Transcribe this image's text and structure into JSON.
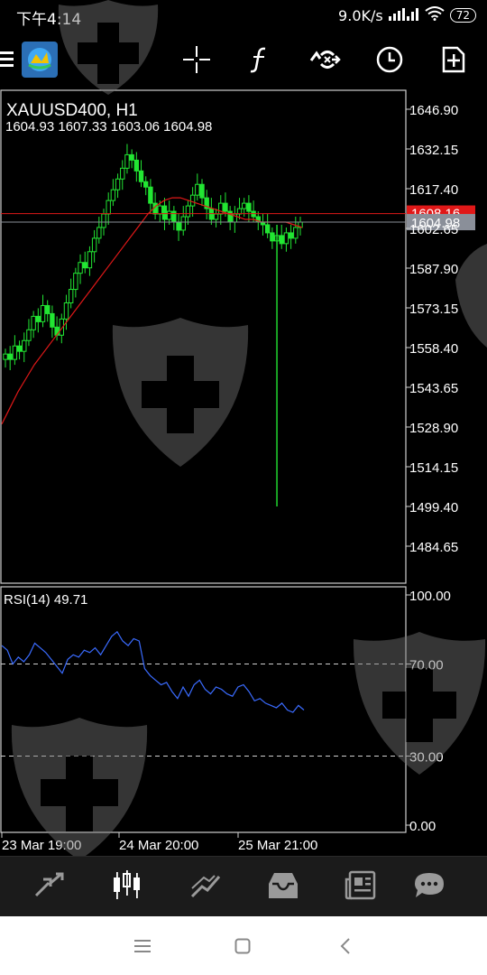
{
  "status_bar": {
    "time": "下午4:14",
    "network_speed": "9.0K/s",
    "battery": "72"
  },
  "toolbar": {
    "buttons": [
      "menu-icon",
      "app-logo-icon",
      "crosshair-icon",
      "function-icon",
      "chart-settings-icon",
      "timeframe-clock-icon",
      "new-order-icon"
    ]
  },
  "chart": {
    "symbol_label": "XAUUSD400, H1",
    "ohlc_label": "1604.93 1607.33 1603.06 1604.98",
    "price_axis": [
      "1646.90",
      "1632.15",
      "1617.40",
      "1602.65",
      "1587.90",
      "1573.15",
      "1558.40",
      "1543.65",
      "1528.90",
      "1514.15",
      "1499.40",
      "1484.65"
    ],
    "ask_label": "1608.16",
    "bid_label": "1604.98",
    "rsi_label": "RSI(14) 49.71",
    "rsi_axis": [
      "100.00",
      "70.00",
      "30.00",
      "0.00"
    ],
    "time_axis": [
      "23 Mar 19:00",
      "24 Mar 20:00",
      "25 Mar 21:00"
    ],
    "colors": {
      "bull": "#22e633",
      "ma": "#e01818",
      "rsi": "#3a6bff",
      "ask": "#e01818",
      "bid": "#8a8f99"
    }
  },
  "bottom_nav": {
    "items": [
      "quotes-icon",
      "chart-icon",
      "trade-icon",
      "history-icon",
      "news-icon",
      "chat-icon"
    ]
  },
  "chart_data": {
    "type": "candlestick",
    "title": "XAUUSD400, H1",
    "ylim": [
      1484.65,
      1646.9
    ],
    "y_ticks": [
      1646.9,
      1632.15,
      1617.4,
      1602.65,
      1587.9,
      1573.15,
      1558.4,
      1543.65,
      1528.9,
      1514.15,
      1499.4,
      1484.65
    ],
    "x_tick_labels": [
      "23 Mar 19:00",
      "24 Mar 20:00",
      "25 Mar 21:00"
    ],
    "last_ohlc": {
      "open": 1604.93,
      "high": 1607.33,
      "low": 1603.06,
      "close": 1604.98
    },
    "current_ask": 1608.16,
    "current_bid": 1604.98,
    "close_series": [
      1556,
      1554,
      1559,
      1557,
      1561,
      1565,
      1570,
      1568,
      1574,
      1571,
      1566,
      1563,
      1569,
      1575,
      1580,
      1586,
      1590,
      1588,
      1594,
      1599,
      1603,
      1608,
      1613,
      1617,
      1621,
      1625,
      1630,
      1628,
      1624,
      1620,
      1618,
      1612,
      1608,
      1611,
      1606,
      1609,
      1605,
      1602,
      1607,
      1611,
      1615,
      1619,
      1614,
      1610,
      1606,
      1608,
      1612,
      1609,
      1605,
      1608,
      1610,
      1612,
      1609,
      1607,
      1605,
      1604,
      1601,
      1598,
      1600,
      1597,
      1601,
      1599,
      1603,
      1605
    ],
    "spike_low": 1499.4,
    "ma_series": [
      1530,
      1536,
      1542,
      1547,
      1552,
      1556,
      1560,
      1564,
      1568,
      1572,
      1576,
      1580,
      1584,
      1588,
      1592,
      1596,
      1600,
      1604,
      1608,
      1611,
      1613,
      1614,
      1614,
      1613,
      1612,
      1611,
      1610,
      1609,
      1608,
      1607,
      1606,
      1606,
      1605,
      1605,
      1605,
      1605,
      1604,
      1603
    ],
    "rsi": {
      "name": "RSI(14) 49.71",
      "ylim": [
        0,
        100
      ],
      "levels": [
        70,
        30
      ],
      "values": [
        78,
        76,
        70,
        73,
        71,
        74,
        79,
        77,
        75,
        72,
        69,
        66,
        72,
        74,
        73,
        76,
        75,
        77,
        74,
        78,
        82,
        84,
        80,
        78,
        81,
        80,
        68,
        65,
        63,
        61,
        62,
        58,
        55,
        60,
        56,
        61,
        63,
        59,
        57,
        60,
        59,
        57,
        56,
        60,
        61,
        58,
        54,
        55,
        53,
        52,
        51,
        53,
        50,
        49,
        52,
        50
      ]
    }
  }
}
